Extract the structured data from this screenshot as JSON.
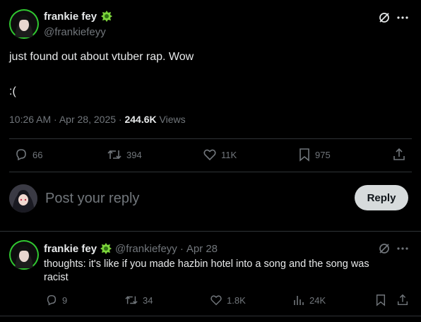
{
  "post": {
    "author_name": "frankie fey",
    "author_handle": "@frankiefeyy",
    "text_line1": "just found out about vtuber rap. Wow",
    "text_line2": ":(",
    "time": "10:26 AM",
    "date": "Apr 28, 2025",
    "separator": "·",
    "views_count": "244.6K",
    "views_label": "Views",
    "stats": {
      "replies": "66",
      "reposts": "394",
      "likes": "11K",
      "bookmarks": "975"
    }
  },
  "composer": {
    "placeholder": "Post your reply",
    "button_label": "Reply"
  },
  "reply": {
    "author_name": "frankie fey",
    "author_handle": "@frankiefeyy",
    "separator": "·",
    "date": "Apr 28",
    "text_line1": "thoughts: it's like if you made hazbin hotel into a song and the song was",
    "text_line2": "racist",
    "stats": {
      "replies": "9",
      "reposts": "34",
      "likes": "1.8K",
      "views": "24K"
    }
  },
  "colors": {
    "background": "#000000",
    "text": "#e7e9ea",
    "muted": "#71767b",
    "divider": "#2f3336",
    "avatar_ring": "#3fd63f",
    "badge": "#7bd33a"
  }
}
